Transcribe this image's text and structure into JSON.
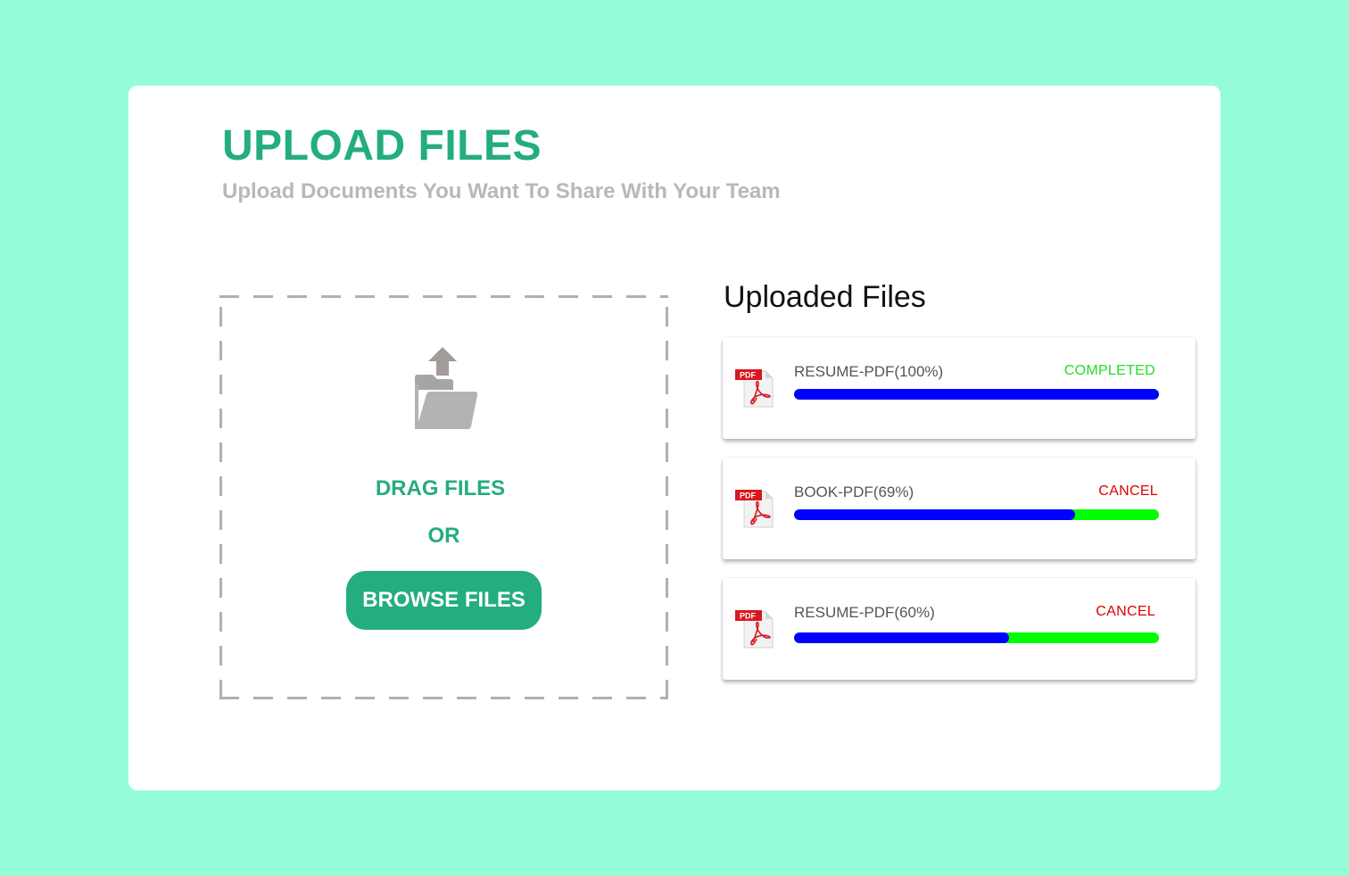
{
  "header": {
    "title": "UPLOAD FILES",
    "subtitle": "Upload Documents You Want To Share With Your Team"
  },
  "dropzone": {
    "icon": "folder-upload-icon",
    "drag_label": "DRAG FILES",
    "or_label": "OR",
    "browse_label": "BROWSE FILES"
  },
  "uploaded": {
    "heading": "Uploaded Files",
    "files": [
      {
        "name": "RESUME-PDF(100%)",
        "status": "COMPLETED",
        "progress": 100,
        "icon": "pdf-icon"
      },
      {
        "name": "BOOK-PDF(69%)",
        "status": "CANCEL",
        "progress": 77,
        "icon": "pdf-icon"
      },
      {
        "name": "RESUME-PDF(60%)",
        "status": "CANCEL",
        "progress": 59,
        "icon": "pdf-icon"
      }
    ]
  },
  "colors": {
    "background": "#94fdd7",
    "accent": "#24ad7e",
    "progress_fill": "#0000ff",
    "progress_track": "#00ff00",
    "completed": "#22e022",
    "cancel": "#e00000"
  }
}
